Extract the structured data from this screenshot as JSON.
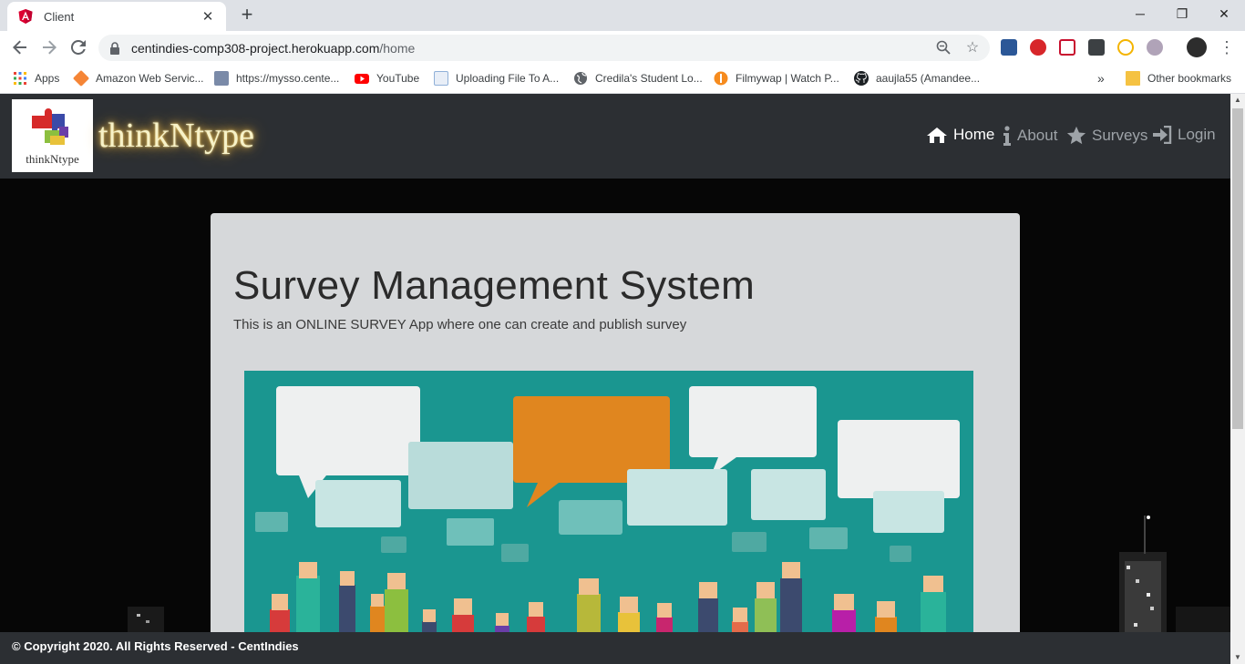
{
  "browser": {
    "tab": {
      "title": "Client",
      "favicon": "angular-icon"
    },
    "window_controls": {
      "minimize": "─",
      "restore": "❐",
      "close": "✕"
    },
    "address": {
      "host": "centindies-comp308-project.herokuapp.com",
      "path": "/home"
    },
    "bookmarks": [
      {
        "label": "Apps",
        "icon": "apps-grid-icon"
      },
      {
        "label": "Amazon Web Servic...",
        "icon": "aws-icon"
      },
      {
        "label": "https://mysso.cente...",
        "icon": "page-icon"
      },
      {
        "label": "YouTube",
        "icon": "youtube-icon"
      },
      {
        "label": "Uploading File To A...",
        "icon": "file-icon"
      },
      {
        "label": "Credila's Student Lo...",
        "icon": "globe-icon"
      },
      {
        "label": "Filmywap | Watch P...",
        "icon": "filmywap-icon"
      },
      {
        "label": "aaujla55 (Amandee...",
        "icon": "github-icon"
      }
    ],
    "bookmarks_overflow": "»",
    "other_bookmarks": "Other bookmarks"
  },
  "site": {
    "logo_text": "thinkNtype",
    "brand": "thinkNtype",
    "nav": [
      {
        "label": "Home",
        "icon": "home-icon",
        "active": true
      },
      {
        "label": "About",
        "icon": "info-icon",
        "active": false
      },
      {
        "label": "Surveys",
        "icon": "star-icon",
        "active": false
      },
      {
        "label": "Login",
        "icon": "login-icon",
        "active": false
      }
    ],
    "hero": {
      "title": "Survey Management System",
      "subtitle": "This is an ONLINE SURVEY App where one can create and publish survey"
    },
    "footer": "© Copyright 2020. All Rights Reserved - CentIndies"
  },
  "colors": {
    "navbar": "#2c2f33",
    "jumbotron": "#d6d8da",
    "illustration_bg": "#1a9690",
    "accent_orange": "#e0861f"
  }
}
